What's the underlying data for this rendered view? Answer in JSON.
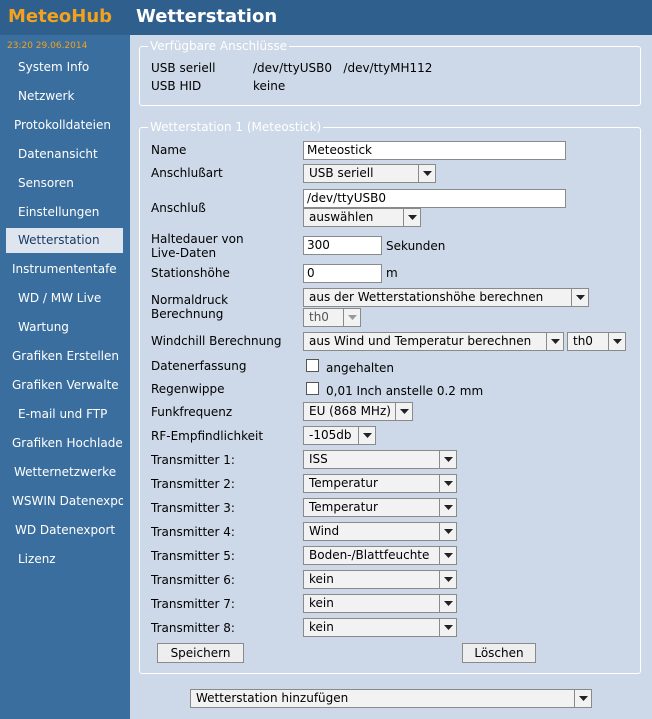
{
  "header": {
    "logo": "MeteoHub",
    "title": "Wetterstation"
  },
  "sidebar": {
    "clock": "23:20   29.06.2014",
    "items": [
      {
        "label": "System Info"
      },
      {
        "label": "Netzwerk"
      },
      {
        "label": "Protokolldateien"
      },
      {
        "label": "Datenansicht"
      },
      {
        "label": "Sensoren"
      },
      {
        "label": "Einstellungen"
      },
      {
        "label": "Wetterstation"
      },
      {
        "label": "Instrumententafe"
      },
      {
        "label": "WD / MW Live"
      },
      {
        "label": "Wartung"
      },
      {
        "label": "Grafiken Erstellen"
      },
      {
        "label": "Grafiken Verwalte"
      },
      {
        "label": "E-mail und FTP"
      },
      {
        "label": "Grafiken Hochlade"
      },
      {
        "label": "Wetternetzwerke"
      },
      {
        "label": "WSWIN Datenexpo"
      },
      {
        "label": "WD Datenexport"
      },
      {
        "label": "Lizenz"
      }
    ]
  },
  "ports": {
    "legend": "Verfügbare Anschlüsse",
    "usb_serial_label": "USB seriell",
    "usb_serial_value": "/dev/ttyUSB0   /dev/ttyMH112",
    "usb_hid_label": "USB HID",
    "usb_hid_value": "keine"
  },
  "station": {
    "legend": "Wetterstation 1 (Meteostick)",
    "name_label": "Name",
    "name_value": "Meteostick",
    "conn_type_label": "Anschlußart",
    "conn_type_value": "USB seriell",
    "conn_label": "Anschluß",
    "conn_value": "/dev/ttyUSB0",
    "conn_select": "auswählen",
    "hold_label_1": "Haltedauer von",
    "hold_label_2": "Live-Daten",
    "hold_value": "300",
    "hold_unit": "Sekunden",
    "alt_label": "Stationshöhe",
    "alt_value": "0",
    "alt_unit": "m",
    "pressure_label_1": "Normaldruck",
    "pressure_label_2": "Berechnung",
    "pressure_method": "aus der Wetterstationshöhe berechnen",
    "pressure_sensor": "th0",
    "windchill_label": "Windchill Berechnung",
    "windchill_method": "aus Wind und Temperatur berechnen",
    "windchill_sensor": "th0",
    "datacapture_label": "Datenerfassung",
    "datacapture_checkbox": "angehalten",
    "rain_label": "Regenwippe",
    "rain_checkbox": "0,01 Inch anstelle 0.2 mm",
    "freq_label": "Funkfrequenz",
    "freq_value": "EU (868 MHz)",
    "rf_label": "RF-Empfindlichkeit",
    "rf_value": "-105db",
    "transmitters": [
      {
        "label": "Transmitter 1:",
        "value": "ISS"
      },
      {
        "label": "Transmitter 2:",
        "value": "Temperatur"
      },
      {
        "label": "Transmitter 3:",
        "value": "Temperatur"
      },
      {
        "label": "Transmitter 4:",
        "value": "Wind"
      },
      {
        "label": "Transmitter 5:",
        "value": "Boden-/Blattfeuchte"
      },
      {
        "label": "Transmitter 6:",
        "value": "kein"
      },
      {
        "label": "Transmitter 7:",
        "value": "kein"
      },
      {
        "label": "Transmitter 8:",
        "value": "kein"
      }
    ],
    "save_label": "Speichern",
    "delete_label": "Löschen"
  },
  "add_station": {
    "value": "Wetterstation hinzufügen"
  },
  "colors": {
    "header_bg": "#2f5f8c",
    "sidebar_bg": "#3a6e9e",
    "logo": "#f3a21e",
    "content_bg": "#cdd9e8",
    "active_item_bg": "#dfe5ee"
  }
}
